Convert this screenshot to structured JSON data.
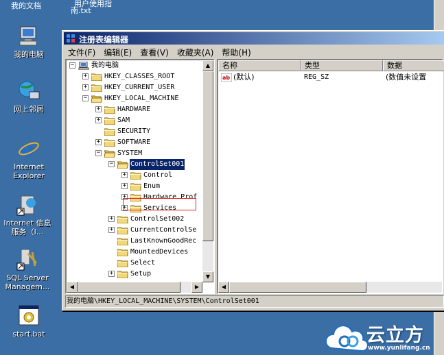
{
  "desktop": {
    "top_fragments": [
      "我的文档",
      "用户使用指",
      "南.txt"
    ],
    "icons": [
      {
        "label": "我的电脑"
      },
      {
        "label": "网上邻居"
      },
      {
        "label": "Internet Explorer"
      },
      {
        "label": "Internet 信息服务（I..."
      },
      {
        "label": "SQL Server Managem..."
      },
      {
        "label": "start.bat"
      }
    ]
  },
  "window": {
    "title": "注册表编辑器",
    "menu": [
      "文件(F)",
      "编辑(E)",
      "查看(V)",
      "收藏夹(A)",
      "帮助(H)"
    ],
    "tree": {
      "root": "我的电脑",
      "hklm_children": [
        "HARDWARE",
        "SAM",
        "SECURITY",
        "SOFTWARE",
        "SYSTEM"
      ],
      "hives": [
        "HKEY_CLASSES_ROOT",
        "HKEY_CURRENT_USER",
        "HKEY_LOCAL_MACHINE"
      ],
      "system_children": [
        "ControlSet001",
        "ControlSet002",
        "CurrentControlSe",
        "LastKnownGoodRec",
        "MountedDevices",
        "Select",
        "Setup"
      ],
      "controlset_children": [
        "Control",
        "Enum",
        "Hardware Prof",
        "Services"
      ]
    },
    "list": {
      "columns": [
        "名称",
        "类型",
        "数据"
      ],
      "rows": [
        {
          "name": "(默认)",
          "type": "REG_SZ",
          "data": "(数值未设置"
        }
      ]
    },
    "status": "我的电脑\\HKEY_LOCAL_MACHINE\\SYSTEM\\ControlSet001",
    "highlight_color": "#e02020"
  },
  "watermark": {
    "brand": "云立方",
    "url": "www.yunlifang.cn"
  }
}
